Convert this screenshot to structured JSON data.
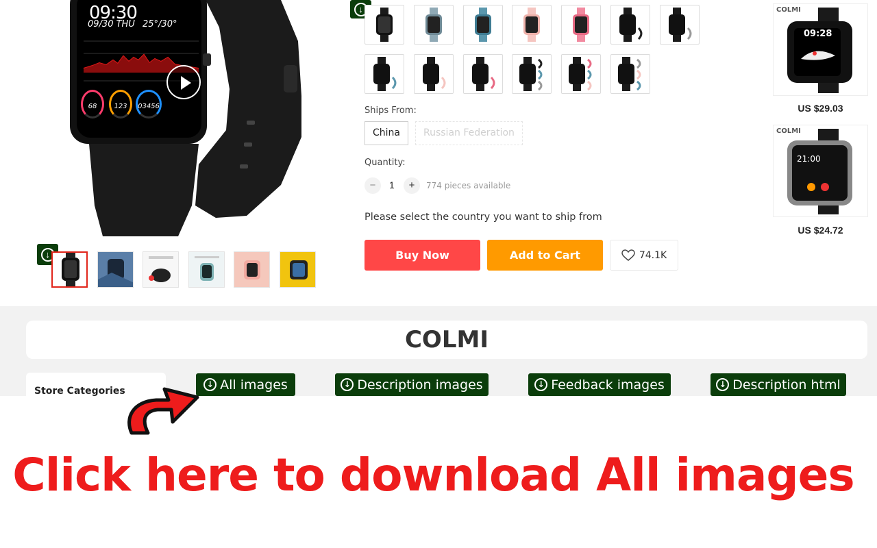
{
  "watch_face": {
    "time": "09:30",
    "date": "09/30 THU",
    "temperature": "25°/30°",
    "stats": [
      "68",
      "123",
      "03456"
    ]
  },
  "product_options": {
    "ships_from_label": "Ships From:",
    "ships_from_options": [
      "China",
      "Russian Federation"
    ],
    "selected_ship_from": "China",
    "quantity_label": "Quantity:",
    "quantity_value": "1",
    "quantity_decrease": "−",
    "quantity_increase": "+",
    "availability": "774 pieces available",
    "select_country_message": "Please select the country you want to ship from"
  },
  "actions": {
    "buy_now": "Buy Now",
    "add_to_cart": "Add to Cart",
    "wishlist_count": "74.1K"
  },
  "recommendations": [
    {
      "brand": "COLMI",
      "watch_time": "09:28",
      "price": "US $29.03"
    },
    {
      "brand": "COLMI",
      "watch_time": "21:00",
      "price": "US $24.72"
    }
  ],
  "store": {
    "name": "COLMI",
    "categories_label": "Store Categories"
  },
  "download_buttons": {
    "all_images": "All images",
    "description_images": "Description images",
    "feedback_images": "Feedback images",
    "description_html": "Description html"
  },
  "promo": {
    "headline": "Click here to download All images"
  },
  "colors": {
    "buy_now": "#ff4747",
    "add_to_cart": "#ff9a00",
    "download_green": "#0b3d0b",
    "promo_red": "#ee1c1c",
    "active_thumb_border": "#e1251b"
  }
}
